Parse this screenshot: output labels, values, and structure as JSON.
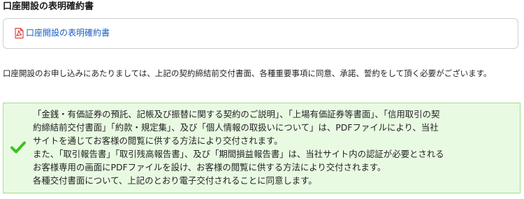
{
  "section": {
    "title": "口座開設の表明確約書"
  },
  "document_link": {
    "icon": "pdf-icon",
    "label": "口座開設の表明確約書"
  },
  "notice": {
    "text": "口座開設のお申し込みにあたりましては、上記の契約締結前交付書面、各種重要事項に同意、承諾、誓約をして頂く必要がございます。"
  },
  "agreement": {
    "checked": true,
    "icon": "check-icon",
    "lines": [
      "「金銭・有価証券の預託、記帳及び振替に関する契約のご説明」、「上場有価証券等書面」、「信用取引の契",
      "約締結前交付書面」「約款・規定集」、及び「個人情報の取扱いについて」は、PDFファイルにより、当社",
      "サイトを通じてお客様の閲覧に供する方法により交付されます。",
      "また、「取引報告書」「取引残高報告書」、及び「期間損益報告書」は、当社サイト内の認証が必要とされる",
      "お客様専用の画面にPDFファイルを設け、お客様の閲覧に供する方法により交付されます。",
      "各種交付書面について、上記のとおり電子交付されることに同意します。"
    ]
  },
  "colors": {
    "link": "#1a5fc0",
    "agree_background": "#e9fae3",
    "agree_border": "#9ee27f",
    "check": "#3dc21f",
    "pdf_icon": "#d9261c"
  }
}
